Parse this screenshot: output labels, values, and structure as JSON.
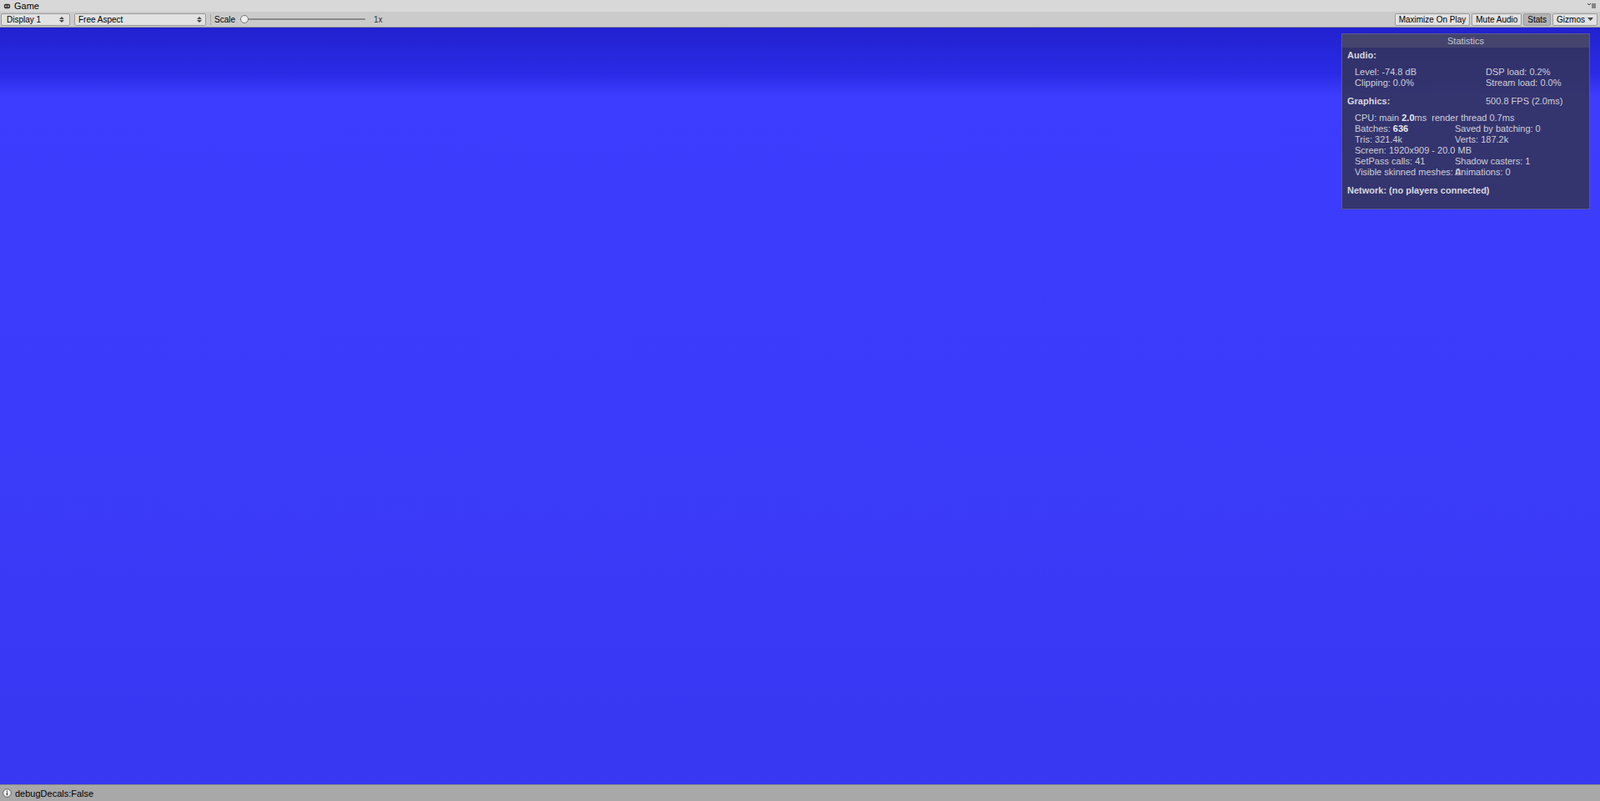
{
  "window": {
    "title": "Game"
  },
  "toolbar": {
    "display": "Display 1",
    "aspect": "Free Aspect",
    "scale_label": "Scale",
    "scale_level": 0.0,
    "scale_value": "1x",
    "buttons": [
      {
        "label": "Maximize On Play",
        "selected": false
      },
      {
        "label": "Mute Audio",
        "selected": false
      },
      {
        "label": "Stats",
        "selected": true
      },
      {
        "label": "Gizmos",
        "selected": false
      }
    ]
  },
  "stats": {
    "title": "Statistics",
    "sections": [
      {
        "header": "Audio:",
        "rows": [
          [
            [
              {
                "text": "Level: -74.8 dB",
                "bold": false
              }
            ],
            [
              {
                "text": "DSP load: 0.2%",
                "bold": false
              }
            ]
          ],
          [
            [
              {
                "text": "Clipping: 0.0%",
                "bold": false
              }
            ],
            [
              {
                "text": "Stream load: 0.0%",
                "bold": false
              }
            ]
          ]
        ]
      },
      {
        "header": "Graphics:",
        "header_right": "500.8 FPS (2.0ms)",
        "rows": [
          [
            [
              {
                "text": "CPU: main ",
                "bold": false
              },
              {
                "text": "2.0",
                "bold": true
              },
              {
                "text": "ms  render thread 0.7ms",
                "bold": false
              }
            ]
          ],
          [
            [
              {
                "text": "Batches: ",
                "bold": false
              },
              {
                "text": "636",
                "bold": true
              }
            ],
            [
              {
                "text": "Saved by batching: 0",
                "bold": false
              }
            ]
          ],
          [
            [
              {
                "text": "Tris: 321.4k",
                "bold": false
              }
            ],
            [
              {
                "text": "Verts: 187.2k",
                "bold": false
              }
            ]
          ],
          [
            [
              {
                "text": "Screen: 1920x909 - 20.0 MB",
                "bold": false
              }
            ]
          ],
          [
            [
              {
                "text": "SetPass calls: 41",
                "bold": false
              }
            ],
            [
              {
                "text": "Shadow casters: 1",
                "bold": false
              }
            ]
          ],
          [
            [
              {
                "text": "Visible skinned meshes: 0",
                "bold": false
              }
            ],
            [
              {
                "text": "Animations: 0",
                "bold": false
              }
            ]
          ]
        ]
      },
      {
        "header": "Network: (no players connected)",
        "rows": []
      }
    ]
  },
  "status_bar": {
    "message": "debugDecals:False"
  }
}
